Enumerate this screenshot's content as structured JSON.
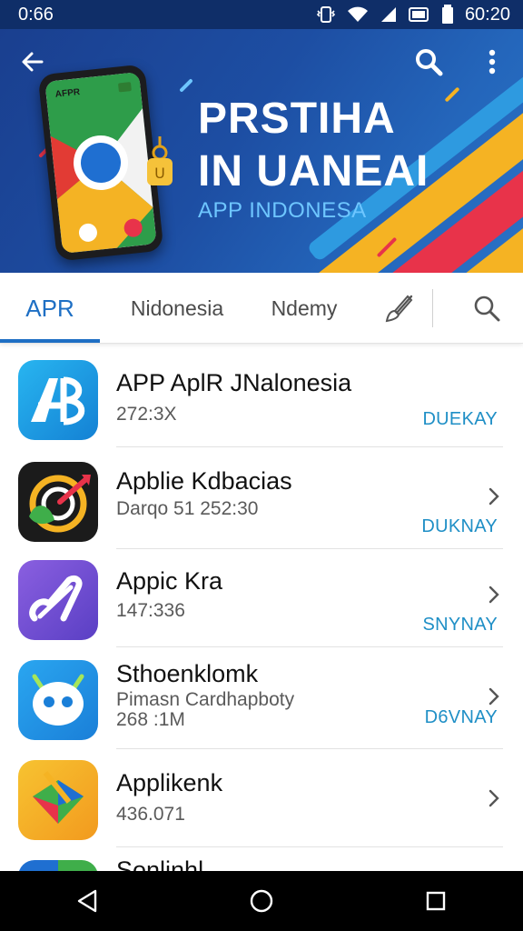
{
  "status_bar": {
    "time": "0:66",
    "clock_right": "60:20",
    "icons": [
      "vibrate-icon",
      "wifi-icon",
      "signal-icon",
      "battery-icon"
    ]
  },
  "banner": {
    "title_line1": "PRSTIHA",
    "title_line2": "IN UANEAI",
    "subtitle": "APP INDONESA",
    "phone_label": "AFPR",
    "icons": [
      "back-arrow-icon",
      "search-icon",
      "more-vert-icon"
    ]
  },
  "tabs": {
    "items": [
      {
        "label": "APR",
        "active": true
      },
      {
        "label": "Nidonesia",
        "active": false
      },
      {
        "label": "Ndemy",
        "active": false
      }
    ],
    "icons": [
      "brush-icon",
      "search-icon"
    ]
  },
  "apps": [
    {
      "name": "APP AplR JNalonesia",
      "meta": "272:3X",
      "meta2": "",
      "action": "DUEKAY",
      "chevron": false,
      "icon": "ap-logo-icon"
    },
    {
      "name": "Apblie Kdbacias",
      "meta": "Darqo 51 252:30",
      "meta2": "",
      "action": "DUKNAY",
      "chevron": true,
      "icon": "target-app-icon"
    },
    {
      "name": "Appic Kra",
      "meta": "147:336",
      "meta2": "",
      "action": "SNYNAY",
      "chevron": true,
      "icon": "music-app-icon"
    },
    {
      "name": "Sthoenklomk",
      "meta": "Pimasn Cardhapboty",
      "meta2": "268 :1M",
      "action": "D6VNAY",
      "chevron": true,
      "icon": "robot-app-icon"
    },
    {
      "name": "Applikenk",
      "meta": "436.071",
      "meta2": "",
      "action": "",
      "chevron": true,
      "icon": "kite-app-icon"
    },
    {
      "name": "Sonlinhl",
      "meta": "",
      "meta2": "",
      "action": "",
      "chevron": false,
      "icon": "partial-app-icon"
    }
  ],
  "nav_bar": {
    "icons": [
      "nav-back-icon",
      "nav-home-icon",
      "nav-recents-icon"
    ]
  },
  "colors": {
    "status_bar": "#0f2e68",
    "banner": "#1d4ea3",
    "accent": "#1e6fc4",
    "action_text": "#1f8fc6",
    "stripe_yellow": "#f5b323",
    "stripe_red": "#e8334a"
  }
}
